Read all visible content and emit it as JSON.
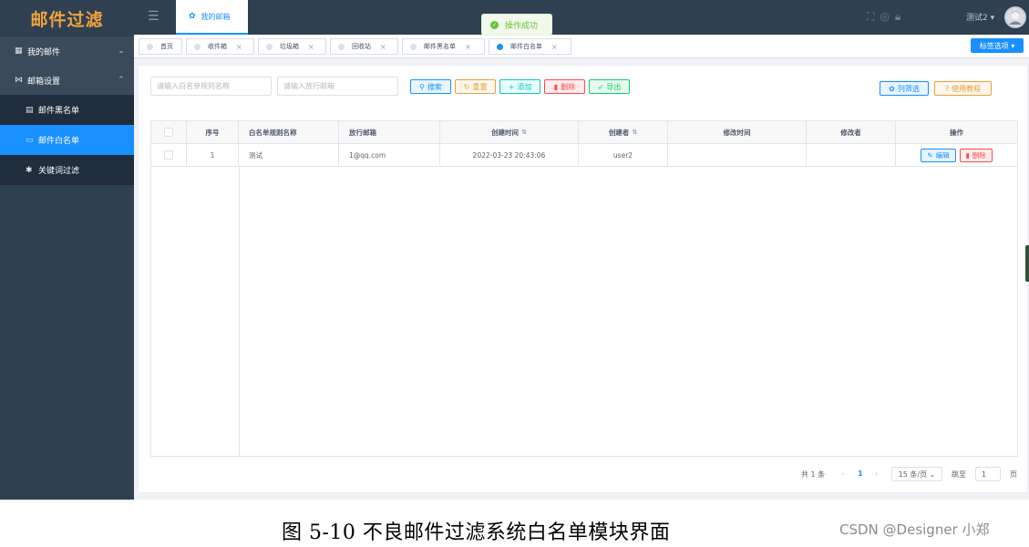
{
  "app": {
    "logo": "邮件过滤"
  },
  "sidebar": {
    "items": [
      {
        "label": "我的邮件",
        "icon": "mail-icon",
        "arrow": "⌄",
        "level": "top"
      },
      {
        "label": "邮箱设置",
        "icon": "settings-icon",
        "arrow": "⌃",
        "level": "top"
      },
      {
        "label": "邮件黑名单",
        "icon": "list-icon",
        "level": "sub"
      },
      {
        "label": "邮件白名单",
        "icon": "window-icon",
        "level": "sub",
        "active": true
      },
      {
        "label": "关键词过滤",
        "icon": "bug-icon",
        "level": "sub"
      }
    ]
  },
  "navbar": {
    "top_tab": "我的邮箱",
    "user": "测试2",
    "user_arrow": "▾"
  },
  "toast": {
    "message": "操作成功"
  },
  "tags": {
    "items": [
      {
        "label": "首页",
        "closable": false
      },
      {
        "label": "收件箱",
        "closable": true
      },
      {
        "label": "垃圾箱",
        "closable": true
      },
      {
        "label": "回收站",
        "closable": true
      },
      {
        "label": "邮件黑名单",
        "closable": true
      },
      {
        "label": "邮件白名单",
        "closable": true,
        "active": true
      }
    ],
    "close_glyph": "×",
    "options_label": "标签选项 ▾"
  },
  "search": {
    "rule_name_placeholder": "请输入白名单规则名称",
    "mail_placeholder": "请输入放行邮箱",
    "search_label": "搜索",
    "reset_label": "重置",
    "add_label": "添加",
    "delete_label": "删除",
    "export_label": "导出",
    "column_filter_label": "列筛选",
    "tutorial_label": "使用教程"
  },
  "table": {
    "columns": [
      "",
      "序号",
      "白名单规则名称",
      "放行邮箱",
      "创建时间",
      "创建者",
      "修改时间",
      "修改者",
      "操作"
    ],
    "rows": [
      {
        "index": "1",
        "rule_name": "测试",
        "mail": "1@qq.com",
        "created_at": "2022-03-23 20:43:06",
        "creator": "user2",
        "modified_at": "",
        "modifier": ""
      }
    ],
    "edit_label": "编辑",
    "delete_label": "删除"
  },
  "pagination": {
    "total": "共 1 条",
    "prev": "‹",
    "current_page": "1",
    "next": "›",
    "page_size": "15 条/页 ⌄",
    "goto_label": "跳至",
    "goto_value": "1",
    "page_label": "页"
  },
  "caption": {
    "text": "图 5-10  不良邮件过滤系统白名单模块界面",
    "watermark": "CSDN @Designer 小郑"
  },
  "colors": {
    "sidebar_bg": "#2f4050",
    "primary": "#1890ff",
    "danger": "#ff4949",
    "warning": "#e6a23c",
    "success": "#13ce66",
    "toast_green": "#67c23a"
  }
}
